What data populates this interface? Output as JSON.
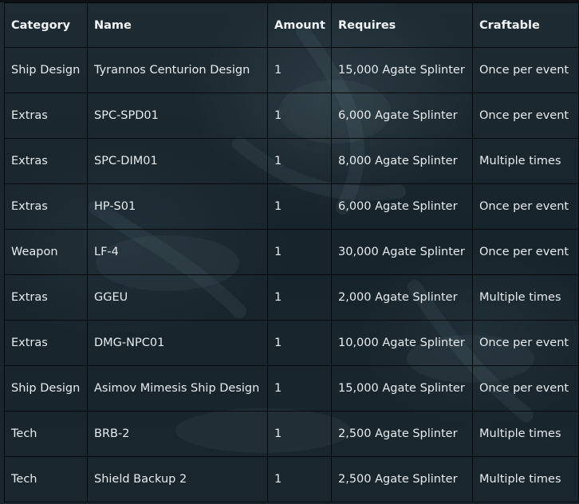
{
  "table": {
    "headers": {
      "category": "Category",
      "name": "Name",
      "amount": "Amount",
      "requires": "Requires",
      "craftable": "Craftable"
    },
    "rows": [
      {
        "category": "Ship Design",
        "name": "Tyrannos Centurion Design",
        "amount": "1",
        "requires": "15,000 Agate Splinter",
        "craftable": "Once per event"
      },
      {
        "category": "Extras",
        "name": "SPC-SPD01",
        "amount": "1",
        "requires": "6,000 Agate Splinter",
        "craftable": "Once per event"
      },
      {
        "category": "Extras",
        "name": "SPC-DIM01",
        "amount": "1",
        "requires": "8,000 Agate Splinter",
        "craftable": "Multiple times"
      },
      {
        "category": "Extras",
        "name": "HP-S01",
        "amount": "1",
        "requires": "6,000 Agate Splinter",
        "craftable": "Once per event"
      },
      {
        "category": "Weapon",
        "name": "LF-4",
        "amount": "1",
        "requires": "30,000 Agate Splinter",
        "craftable": "Once per event"
      },
      {
        "category": "Extras",
        "name": "GGEU",
        "amount": "1",
        "requires": "2,000 Agate Splinter",
        "craftable": "Multiple times"
      },
      {
        "category": "Extras",
        "name": "DMG-NPC01",
        "amount": "1",
        "requires": "10,000 Agate Splinter",
        "craftable": "Once per event"
      },
      {
        "category": "Ship Design",
        "name": "Asimov Mimesis Ship Design",
        "amount": "1",
        "requires": "15,000 Agate Splinter",
        "craftable": "Once per event"
      },
      {
        "category": "Tech",
        "name": "BRB-2",
        "amount": "1",
        "requires": "2,500 Agate Splinter",
        "craftable": "Multiple times"
      },
      {
        "category": "Tech",
        "name": "Shield Backup 2",
        "amount": "1",
        "requires": "2,500 Agate Splinter",
        "craftable": "Multiple times"
      }
    ]
  },
  "colors": {
    "background": "#18242c",
    "grid_lines": "#06090b",
    "text": "#e6ebee"
  }
}
